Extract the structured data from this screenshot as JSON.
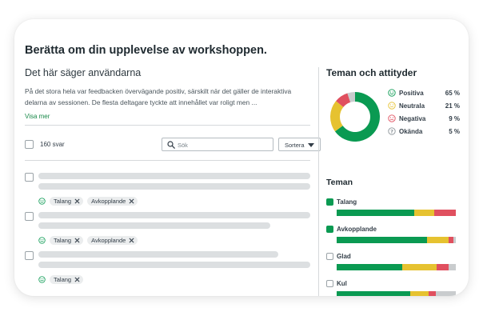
{
  "title": "Berätta om din upplevelse av workshoppen.",
  "feedback": {
    "heading": "Det här säger användarna",
    "summary": "På det stora hela var feedbacken övervägande positiv, särskilt när det gäller de interaktiva delarna av sessionen. De flesta deltagare tyckte att innehållet var roligt men ...",
    "see_more": "Visa mer"
  },
  "toolbar": {
    "count_label": "160 svar",
    "search_placeholder": "Sök",
    "sort_label": "Sortera"
  },
  "responses": [
    {
      "tags": [
        "Talang",
        "Avkopplande"
      ]
    },
    {
      "tags": [
        "Talang",
        "Avkopplande"
      ]
    },
    {
      "tags": [
        "Talang"
      ]
    }
  ],
  "attitudes": {
    "heading": "Teman och attityder",
    "items": [
      {
        "label": "Positiva",
        "pct": "65 %",
        "value": 65,
        "color": "#0a9a52",
        "icon": "happy-face-icon"
      },
      {
        "label": "Neutrala",
        "pct": "21 %",
        "value": 21,
        "color": "#e6c230",
        "icon": "neutral-face-icon"
      },
      {
        "label": "Negativa",
        "pct": "9 %",
        "value": 9,
        "color": "#e0505f",
        "icon": "sad-face-icon"
      },
      {
        "label": "Okända",
        "pct": "5 %",
        "value": 5,
        "color": "#c9ccce",
        "icon": "question-face-icon"
      }
    ]
  },
  "themes": {
    "heading": "Teman",
    "items": [
      {
        "name": "Talang",
        "checked": true,
        "segments": [
          65,
          17,
          18,
          0
        ]
      },
      {
        "name": "Avkopplande",
        "checked": true,
        "segments": [
          76,
          18,
          4,
          2
        ]
      },
      {
        "name": "Glad",
        "checked": false,
        "segments": [
          55,
          29,
          10,
          6
        ]
      },
      {
        "name": "Kul",
        "checked": false,
        "segments": [
          62,
          15,
          6,
          17
        ]
      }
    ]
  }
}
